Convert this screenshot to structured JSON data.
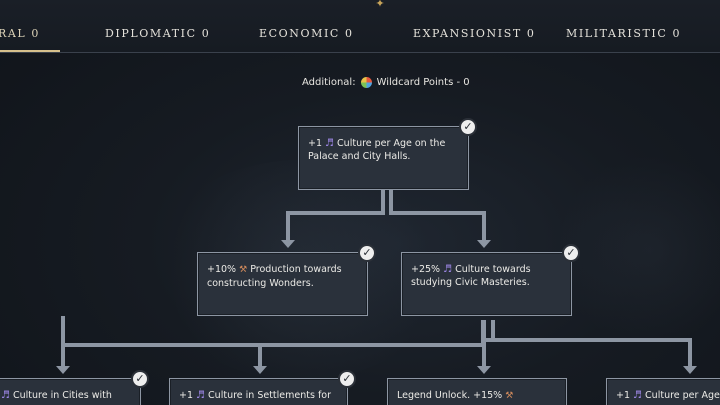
{
  "tabs": [
    {
      "label": "RAL 0"
    },
    {
      "label": "DIPLOMATIC 0"
    },
    {
      "label": "ECONOMIC 0"
    },
    {
      "label": "EXPANSIONIST 0"
    },
    {
      "label": "MILITARISTIC 0"
    }
  ],
  "additional": {
    "label": "Additional:",
    "text": "Wildcard Points - 0"
  },
  "cards": {
    "top": {
      "prefix": "+1",
      "text": "Culture per Age on the Palace and City Halls."
    },
    "mid_left": {
      "prefix": "+10%",
      "text": "Production towards constructing Wonders."
    },
    "mid_right": {
      "prefix": "+25%",
      "text": "Culture towards studying Civic Masteries."
    },
    "bottom_1": {
      "prefix": "",
      "text": "Culture in Cities with"
    },
    "bottom_2": {
      "prefix": "+1",
      "text": "Culture in Settlements for"
    },
    "bottom_3": {
      "prefix": "",
      "text": "Legend Unlock. +15%"
    },
    "bottom_4": {
      "prefix": "+1",
      "text": "Culture per Age"
    }
  },
  "colors": {
    "accent": "#d6c08c",
    "connector": "#8d96a3",
    "culture_icon": "#a48cf0"
  }
}
